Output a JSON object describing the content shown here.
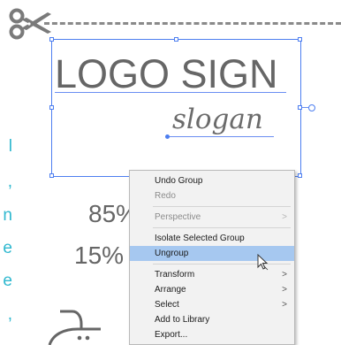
{
  "artwork": {
    "logo_text": "LOGO SIGN",
    "slogan_text": "slogan",
    "side_text": [
      "l",
      ",",
      "n",
      "e",
      "e",
      ","
    ],
    "percent_1": "85%",
    "percent_2": "15%"
  },
  "context_menu": {
    "items": [
      {
        "label": "Undo Group",
        "disabled": false,
        "submenu": false
      },
      {
        "label": "Redo",
        "disabled": true,
        "submenu": false
      },
      {
        "label": "Perspective",
        "disabled": true,
        "submenu": true
      },
      {
        "label": "Isolate Selected Group",
        "disabled": false,
        "submenu": false
      },
      {
        "label": "Ungroup",
        "disabled": false,
        "submenu": false,
        "highlighted": true
      },
      {
        "label": "Transform",
        "disabled": false,
        "submenu": true
      },
      {
        "label": "Arrange",
        "disabled": false,
        "submenu": true
      },
      {
        "label": "Select",
        "disabled": false,
        "submenu": true
      },
      {
        "label": "Add to Library",
        "disabled": false,
        "submenu": false
      },
      {
        "label": "Export...",
        "disabled": false,
        "submenu": false
      }
    ],
    "submenu_arrow": ">"
  },
  "colors": {
    "selection": "#4d7ef0",
    "accent_text": "#2fb8cf",
    "highlight": "#a6c8f0"
  }
}
